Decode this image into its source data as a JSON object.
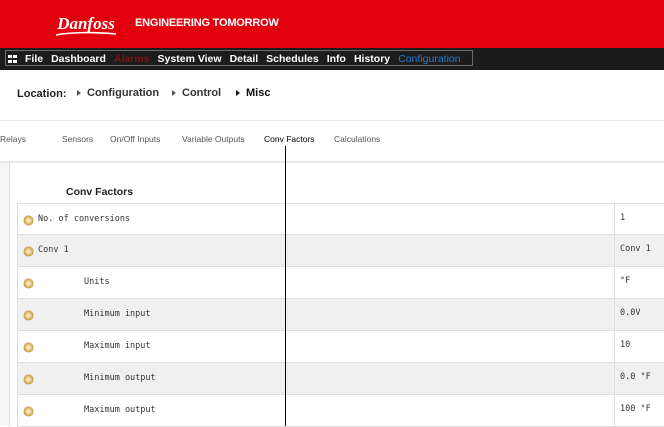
{
  "header": {
    "logo_text": "Danfoss",
    "tagline": "ENGINEERING TOMORROW",
    "brand_color": "#e2000f"
  },
  "navbar": {
    "menu_icon": "grid-icon",
    "items": [
      {
        "label": "File",
        "state": "normal"
      },
      {
        "label": "Dashboard",
        "state": "normal"
      },
      {
        "label": "Alarms",
        "state": "dim"
      },
      {
        "label": "System View",
        "state": "normal"
      },
      {
        "label": "Detail",
        "state": "normal"
      },
      {
        "label": "Schedules",
        "state": "normal"
      },
      {
        "label": "Info",
        "state": "normal"
      },
      {
        "label": "History",
        "state": "normal"
      },
      {
        "label": "Configuration",
        "state": "active"
      }
    ]
  },
  "location": {
    "label": "Location:",
    "crumbs": [
      "Configuration",
      "Control",
      "Misc"
    ]
  },
  "tabs": {
    "items": [
      "Relays",
      "Sensors",
      "On/Off Inputs",
      "Variable Outputs",
      "Conv Factors",
      "Calculations"
    ],
    "selected": "Conv Factors"
  },
  "section": {
    "title": "Conv Factors",
    "rows": [
      {
        "label": "No. of conversions",
        "value": "1",
        "indent": false
      },
      {
        "label": "Conv 1",
        "value": "Conv 1",
        "indent": false
      },
      {
        "label": "Units",
        "value": "°F",
        "indent": true
      },
      {
        "label": "Minimum input",
        "value": "0.0V",
        "indent": true
      },
      {
        "label": "Maximum input",
        "value": "10",
        "indent": true
      },
      {
        "label": "Minimum output",
        "value": "0.0 °F",
        "indent": true
      },
      {
        "label": "Maximum output",
        "value": "100 °F",
        "indent": true
      }
    ]
  }
}
